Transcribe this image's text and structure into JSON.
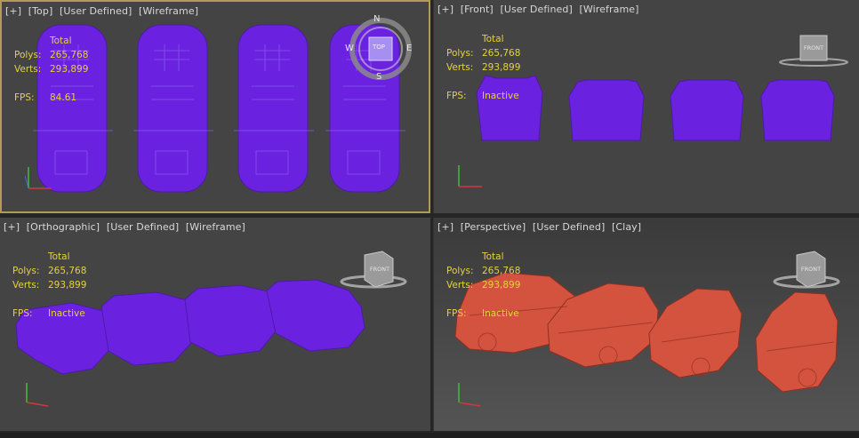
{
  "viewports": {
    "top": {
      "label": [
        "[+]",
        "[Top]",
        "[User Defined]",
        "[Wireframe]"
      ],
      "stats": {
        "header": "Total",
        "polys_label": "Polys:",
        "polys": "265,768",
        "verts_label": "Verts:",
        "verts": "293,899",
        "fps_label": "FPS:",
        "fps": "84.61"
      },
      "compass": {
        "n": "N",
        "s": "S",
        "e": "E",
        "w": "W",
        "cube": "TOP"
      }
    },
    "front": {
      "label": [
        "[+]",
        "[Front]",
        "[User Defined]",
        "[Wireframe]"
      ],
      "stats": {
        "header": "Total",
        "polys_label": "Polys:",
        "polys": "265,768",
        "verts_label": "Verts:",
        "verts": "293,899",
        "fps_label": "FPS:",
        "fps": "Inactive"
      },
      "cube": "FRONT"
    },
    "ortho": {
      "label": [
        "[+]",
        "[Orthographic]",
        "[User Defined]",
        "[Wireframe]"
      ],
      "stats": {
        "header": "Total",
        "polys_label": "Polys:",
        "polys": "265,768",
        "verts_label": "Verts:",
        "verts": "293,899",
        "fps_label": "FPS:",
        "fps": "Inactive"
      },
      "cube": "FRONT"
    },
    "persp": {
      "label": [
        "[+]",
        "[Perspective]",
        "[User Defined]",
        "[Clay]"
      ],
      "stats": {
        "header": "Total",
        "polys_label": "Polys:",
        "polys": "265,768",
        "verts_label": "Verts:",
        "verts": "293,899",
        "fps_label": "FPS:",
        "fps": "Inactive"
      },
      "cube": "FRONT"
    }
  },
  "colors": {
    "wireframe": "#6a22e0",
    "clay": "#d4533f",
    "stats_text": "#e6d23b",
    "active_border": "#b29b57"
  }
}
